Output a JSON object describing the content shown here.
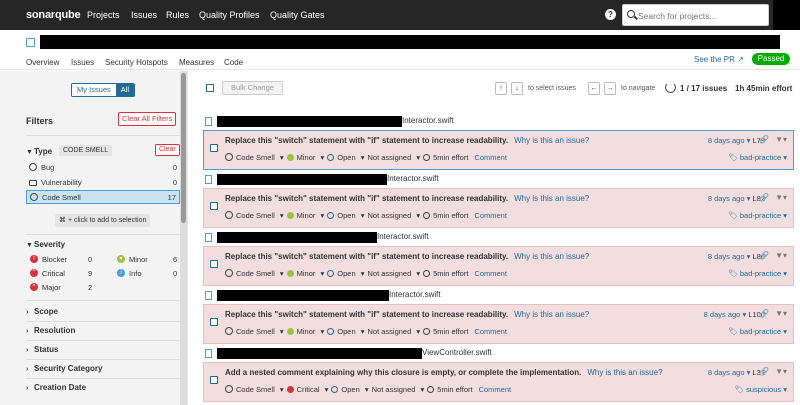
{
  "topnav": {
    "logo": "sonarqube",
    "items": [
      "Projects",
      "Issues",
      "Rules",
      "Quality Profiles",
      "Quality Gates"
    ],
    "help": "?",
    "search_placeholder": "Search for projects..."
  },
  "project": {
    "tabs": [
      "Overview",
      "Issues",
      "Security Hotspots",
      "Measures",
      "Code"
    ],
    "active_tab": "Issues",
    "see_pr": "See the PR",
    "quality_gate": "Passed"
  },
  "sidebar": {
    "my_issues": "My Issues",
    "all": "All",
    "filters_title": "Filters",
    "clear_all": "Clear All Filters",
    "type": {
      "title": "Type",
      "chip": "CODE SMELL",
      "clear": "Clear",
      "items": [
        {
          "label": "Bug",
          "count": "0",
          "icon": "bug-icon"
        },
        {
          "label": "Vulnerability",
          "count": "0",
          "icon": "lock-icon"
        },
        {
          "label": "Code Smell",
          "count": "17",
          "icon": "code-smell-icon"
        }
      ],
      "hint": "⌘ + click to add to selection"
    },
    "severity": {
      "title": "Severity",
      "items": [
        {
          "label": "Blocker",
          "count": "0",
          "color": "#d4333f"
        },
        {
          "label": "Minor",
          "count": "6",
          "color": "#a0c040"
        },
        {
          "label": "Critical",
          "count": "9",
          "color": "#d4333f"
        },
        {
          "label": "Info",
          "count": "0",
          "color": "#4b9fd5"
        },
        {
          "label": "Major",
          "count": "2",
          "color": "#d4333f"
        }
      ]
    },
    "facets": [
      "Scope",
      "Resolution",
      "Status",
      "Security Category",
      "Creation Date"
    ]
  },
  "toolbar": {
    "bulk_change": "Bulk Change",
    "up": "↑",
    "down": "↓",
    "select_hint": "to select issues",
    "left": "←",
    "right": "→",
    "navigate_hint": "to navigate",
    "count": "1 / 17 issues",
    "effort": "1h 45min effort"
  },
  "issues": [
    {
      "file": "Interactor.swift",
      "message": "Replace this \"switch\" statement with \"if\" statement to increase readability.",
      "why": "Why is this an issue?",
      "type": "Code Smell",
      "severity": "Minor",
      "status": "Open",
      "assignee": "Not assigned",
      "effort": "5min effort",
      "comment": "Comment",
      "age": "8 days ago",
      "line": "L79",
      "tag": "bad-practice"
    },
    {
      "file": "Interactor.swift",
      "message": "Replace this \"switch\" statement with \"if\" statement to increase readability.",
      "why": "Why is this an issue?",
      "type": "Code Smell",
      "severity": "Minor",
      "status": "Open",
      "assignee": "Not assigned",
      "effort": "5min effort",
      "comment": "Comment",
      "age": "8 days ago",
      "line": "L82",
      "tag": "bad-practice"
    },
    {
      "file": "Interactor.swift",
      "message": "Replace this \"switch\" statement with \"if\" statement to increase readability.",
      "why": "Why is this an issue?",
      "type": "Code Smell",
      "severity": "Minor",
      "status": "Open",
      "assignee": "Not assigned",
      "effort": "5min effort",
      "comment": "Comment",
      "age": "8 days ago",
      "line": "L86",
      "tag": "bad-practice"
    },
    {
      "file": "Interactor.swift",
      "message": "Replace this \"switch\" statement with \"if\" statement to increase readability.",
      "why": "Why is this an issue?",
      "type": "Code Smell",
      "severity": "Minor",
      "status": "Open",
      "assignee": "Not assigned",
      "effort": "5min effort",
      "comment": "Comment",
      "age": "8 days ago",
      "line": "L100",
      "tag": "bad-practice"
    },
    {
      "file": "ViewController.swift",
      "message": "Add a nested comment explaining why this closure is empty, or complete the implementation.",
      "why": "Why is this an issue?",
      "type": "Code Smell",
      "severity": "Critical",
      "status": "Open",
      "assignee": "Not assigned",
      "effort": "5min effort",
      "comment": "Comment",
      "age": "8 days ago",
      "line": "L31",
      "tag": "suspicious"
    }
  ]
}
